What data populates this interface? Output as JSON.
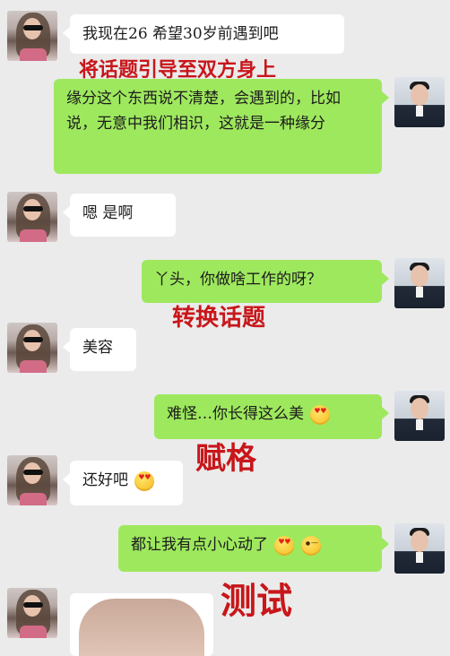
{
  "messages": [
    {
      "side": "left",
      "text": "我现在26 希望30岁前遇到吧"
    },
    {
      "side": "right",
      "text": "缘分这个东西说不清楚，会遇到的，比如说，无意中我们相识，这就是一种缘分"
    },
    {
      "side": "left",
      "text": "嗯  是啊"
    },
    {
      "side": "right",
      "text": "丫头，你做啥工作的呀？"
    },
    {
      "side": "left",
      "text": "美容"
    },
    {
      "side": "right",
      "text": "难怪…你长得这么美",
      "emoji": "heart-eyes-emoji"
    },
    {
      "side": "left",
      "text": "还好吧",
      "emoji": "heart-eyes-emoji"
    },
    {
      "side": "right",
      "text": "都让我有点小心动了",
      "emoji": [
        "heart-eyes-emoji",
        "tongue-wink-emoji"
      ]
    }
  ],
  "annotations": {
    "a1": "将话题引导至双方身上",
    "a2": "转换话题",
    "a3": "赋格",
    "a4": "测试"
  },
  "colors": {
    "background": "#ebebeb",
    "outgoing_bubble": "#9ee85e",
    "incoming_bubble": "#ffffff",
    "annotation": "#c8161a"
  }
}
